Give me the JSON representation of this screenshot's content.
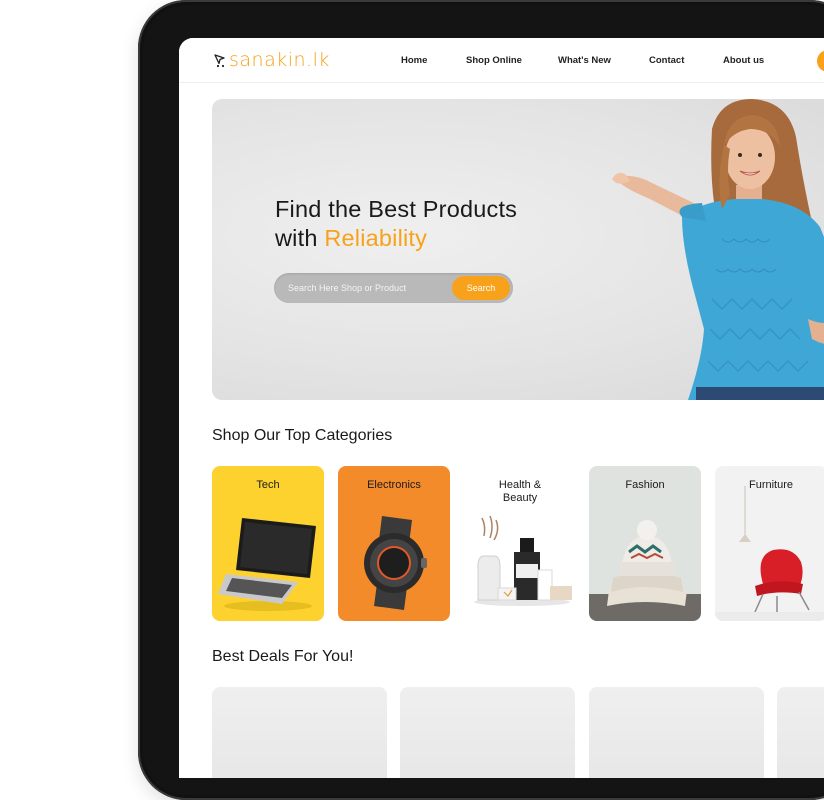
{
  "brand": {
    "logo_text": "sanakin.lk",
    "accent_color": "#f7a21a"
  },
  "nav": {
    "items": [
      {
        "label": "Home"
      },
      {
        "label": "Shop Online"
      },
      {
        "label": "What's New"
      },
      {
        "label": "Contact"
      },
      {
        "label": "About us"
      }
    ]
  },
  "hero": {
    "title_line1": "Find the Best Products",
    "title_line2_prefix": "with",
    "title_line2_accent": "Reliability",
    "search_placeholder": "Search Here Shop or Product",
    "search_value": "",
    "search_button": "Search"
  },
  "categories": {
    "title": "Shop Our Top Categories",
    "items": [
      {
        "label": "Tech",
        "bg": "#fdd22e"
      },
      {
        "label": "Electronics",
        "bg": "#f48b2b"
      },
      {
        "label": "Health &\nBeauty",
        "bg": "#ffffff"
      },
      {
        "label": "Fashion",
        "bg": "#dfe3df"
      },
      {
        "label": "Furniture",
        "bg": "#f2f2f2"
      }
    ]
  },
  "deals": {
    "title": "Best Deals For You!",
    "count_visible": 4
  }
}
